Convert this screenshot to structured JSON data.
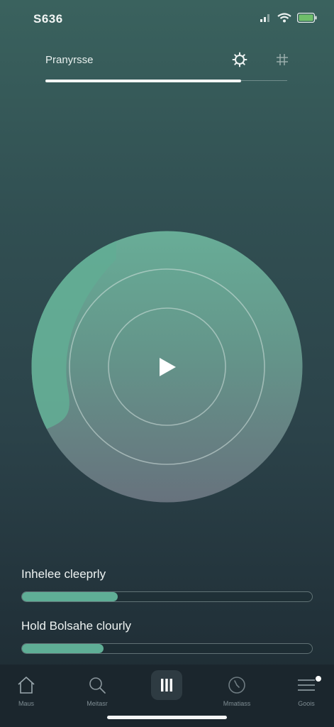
{
  "status_bar": {
    "time": "S636",
    "icons": [
      "signal-icon",
      "wifi-icon",
      "battery-icon"
    ]
  },
  "header": {
    "title": "Pranyrsse",
    "progress": 0.81,
    "buttons": [
      "settings-icon",
      "grid-icon"
    ]
  },
  "player": {
    "play_icon": "play-icon"
  },
  "sliders": [
    {
      "label": "Inhelee cleeprly",
      "value": 0.33
    },
    {
      "label": "Hold Bolsahe clourly",
      "value": 0.28
    }
  ],
  "bottom_nav": {
    "items": [
      {
        "label": "Maus",
        "icon": "home-icon"
      },
      {
        "label": "Meitasr",
        "icon": "search-icon"
      },
      {
        "label": "",
        "icon": "pause-icon"
      },
      {
        "label": "Mmatiass",
        "icon": "timer-icon"
      },
      {
        "label": "Goois",
        "icon": "menu-icon"
      }
    ]
  },
  "colors": {
    "accent": "#5fae96",
    "background_top": "#3a625e",
    "background_bottom": "#1d2a31",
    "nav_background": "#1b262d"
  }
}
